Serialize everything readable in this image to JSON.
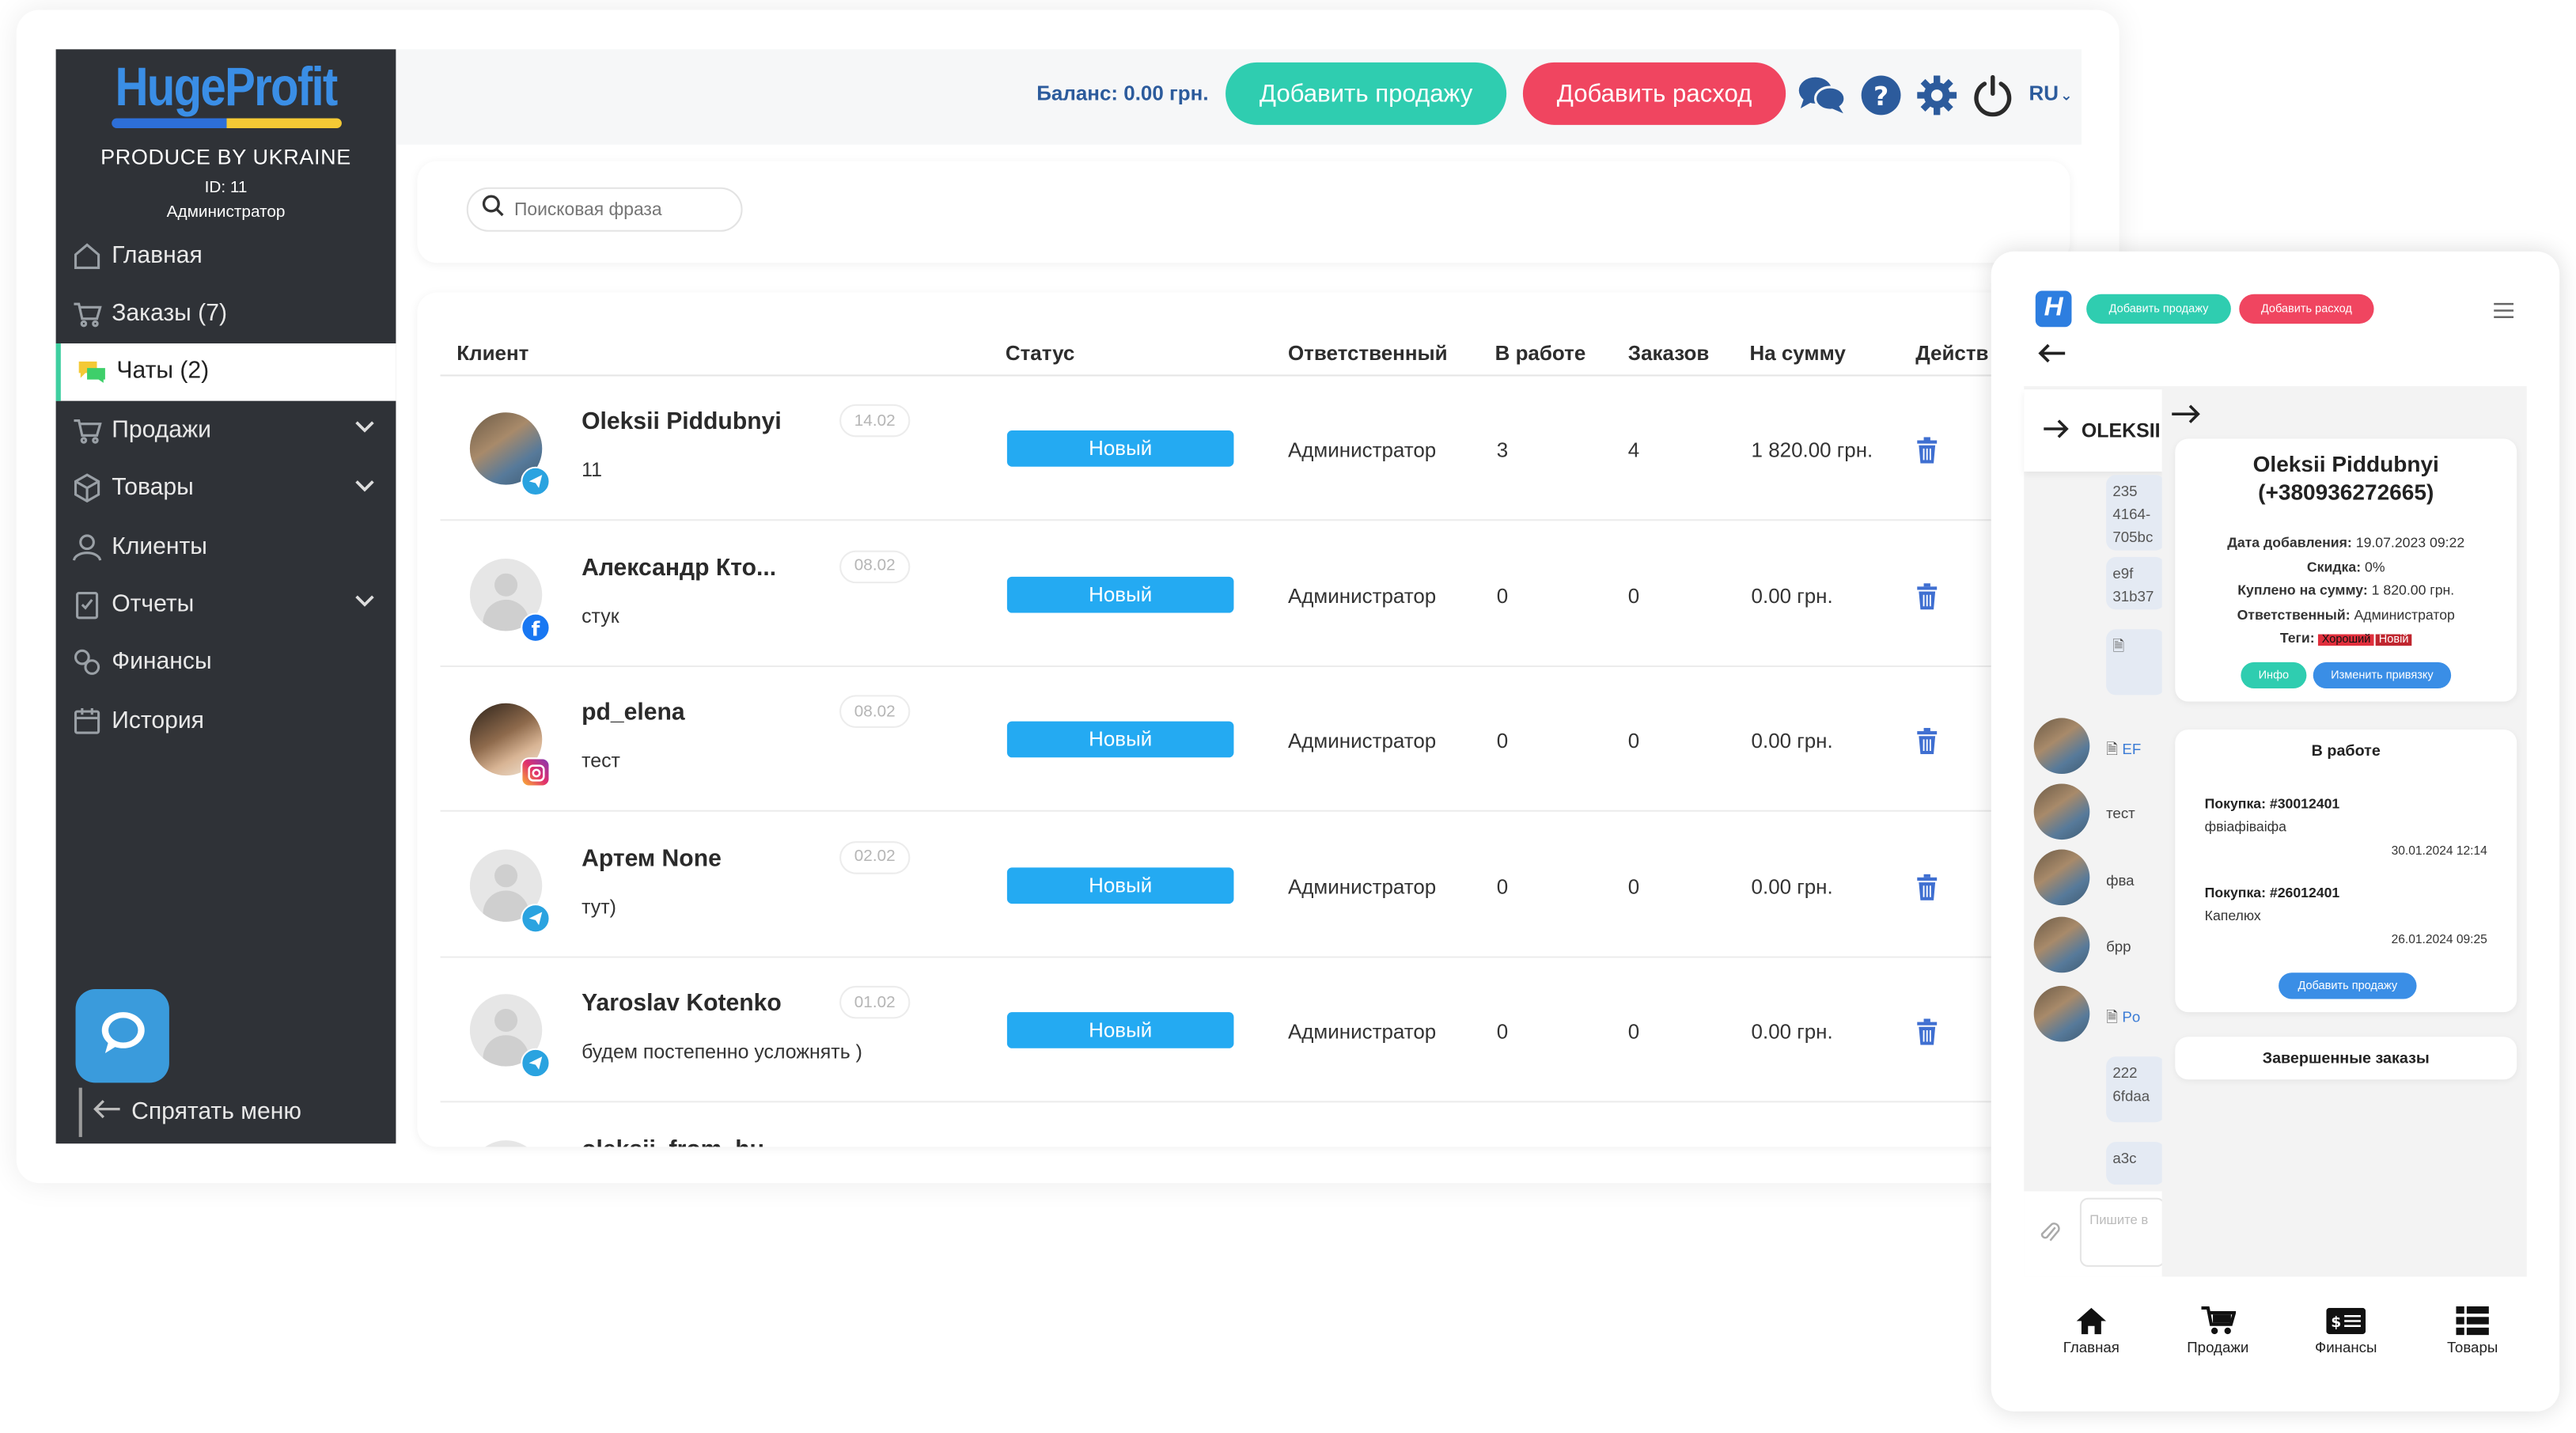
{
  "sidebar": {
    "logo": "HugeProfit",
    "tagline": "PRODUCE BY UKRAINE",
    "user_id": "ID: 11",
    "user_role": "Администратор",
    "items": [
      {
        "label": "Главная",
        "icon": "home-icon",
        "expandable": false,
        "active": false
      },
      {
        "label": "Заказы (7)",
        "icon": "cart-icon",
        "expandable": false,
        "active": false
      },
      {
        "label": "Чаты (2)",
        "icon": "chat-icon",
        "expandable": false,
        "active": true
      },
      {
        "label": "Продажи",
        "icon": "cart-icon",
        "expandable": true,
        "active": false
      },
      {
        "label": "Товары",
        "icon": "box-icon",
        "expandable": true,
        "active": false
      },
      {
        "label": "Клиенты",
        "icon": "user-icon",
        "expandable": false,
        "active": false
      },
      {
        "label": "Отчеты",
        "icon": "report-icon",
        "expandable": true,
        "active": false
      },
      {
        "label": "Финансы",
        "icon": "finance-icon",
        "expandable": false,
        "active": false
      },
      {
        "label": "История",
        "icon": "history-icon",
        "expandable": false,
        "active": false
      }
    ],
    "hide_menu": "Спрятать меню"
  },
  "header": {
    "balance": "Баланс: 0.00 грн.",
    "add_sale": "Добавить продажу",
    "add_expense": "Добавить расход",
    "language": "RU"
  },
  "search": {
    "placeholder": "Поисковая фраза"
  },
  "table": {
    "columns": [
      "Клиент",
      "Статус",
      "Ответственный",
      "В работе",
      "Заказов",
      "На сумму",
      "Действ"
    ],
    "rows": [
      {
        "name": "Oleksii Piddubnyi",
        "message": "11",
        "date": "14.02",
        "status": "Новый",
        "responsible": "Администратор",
        "in_work": "3",
        "orders": "4",
        "sum": "1 820.00 грн.",
        "source": "telegram",
        "avatar": "photo"
      },
      {
        "name": "Александр Кто...",
        "message": "стук",
        "date": "08.02",
        "status": "Новый",
        "responsible": "Администратор",
        "in_work": "0",
        "orders": "0",
        "sum": "0.00 грн.",
        "source": "facebook",
        "avatar": "placeholder"
      },
      {
        "name": "pd_elena",
        "message": "тест",
        "date": "08.02",
        "status": "Новый",
        "responsible": "Администратор",
        "in_work": "0",
        "orders": "0",
        "sum": "0.00 грн.",
        "source": "instagram",
        "avatar": "photo2"
      },
      {
        "name": "Артем None",
        "message": "тут)",
        "date": "02.02",
        "status": "Новый",
        "responsible": "Администратор",
        "in_work": "0",
        "orders": "0",
        "sum": "0.00 грн.",
        "source": "telegram",
        "avatar": "placeholder"
      },
      {
        "name": "Yaroslav Kotenko",
        "message": "будем постепенно усложнять )",
        "date": "01.02",
        "status": "Новый",
        "responsible": "Администратор",
        "in_work": "0",
        "orders": "0",
        "sum": "0.00 грн.",
        "source": "telegram",
        "avatar": "placeholder"
      }
    ],
    "partial_row_name": "oleksii_from_hu..."
  },
  "mobile": {
    "logo_letter": "H",
    "add_sale": "Добавить продажу",
    "add_expense": "Добавить расход",
    "chat_title": "OLEKSII",
    "chat_snippets": [
      "тест",
      "фва",
      "брр"
    ],
    "bubble_texts": [
      "235",
      "4164-",
      "705bc",
      "e9f",
      "31b37",
      "222",
      "6fdaa",
      "a3c"
    ],
    "file_snippets": [
      "EF",
      "Po"
    ],
    "message_placeholder": "Пишите в",
    "client_card": {
      "name": "Oleksii Piddubnyi",
      "phone": "(+380936272665)",
      "date_added_label": "Дата добавления:",
      "date_added": "19.07.2023 09:22",
      "discount_label": "Скидка:",
      "discount": "0%",
      "bought_label": "Куплено на сумму:",
      "bought": "1 820.00 грн.",
      "responsible_label": "Ответственный:",
      "responsible": "Администратор",
      "tags_label": "Теги:",
      "tags": [
        "Хороший",
        "Новій"
      ],
      "info_btn": "Инфо",
      "change_btn": "Изменить привязку"
    },
    "in_work": {
      "title": "В работе",
      "purchases": [
        {
          "title": "Покупка: #30012401",
          "desc": "фвіафіваіфа",
          "date": "30.01.2024 12:14"
        },
        {
          "title": "Покупка: #26012401",
          "desc": "Капелюх",
          "date": "26.01.2024 09:25"
        }
      ],
      "add_sale": "Добавить продажу"
    },
    "completed_title": "Завершенные заказы",
    "nav": [
      {
        "label": "Главная",
        "icon": "home-icon"
      },
      {
        "label": "Продажи",
        "icon": "cart-icon"
      },
      {
        "label": "Финансы",
        "icon": "finance-icon"
      },
      {
        "label": "Товары",
        "icon": "list-icon"
      }
    ]
  },
  "colors": {
    "sidebar_bg": "#2f3237",
    "accent_green": "#2fcdb0",
    "accent_red": "#f04560",
    "status_blue": "#24aaf2",
    "brand_blue": "#2d7ee0"
  }
}
